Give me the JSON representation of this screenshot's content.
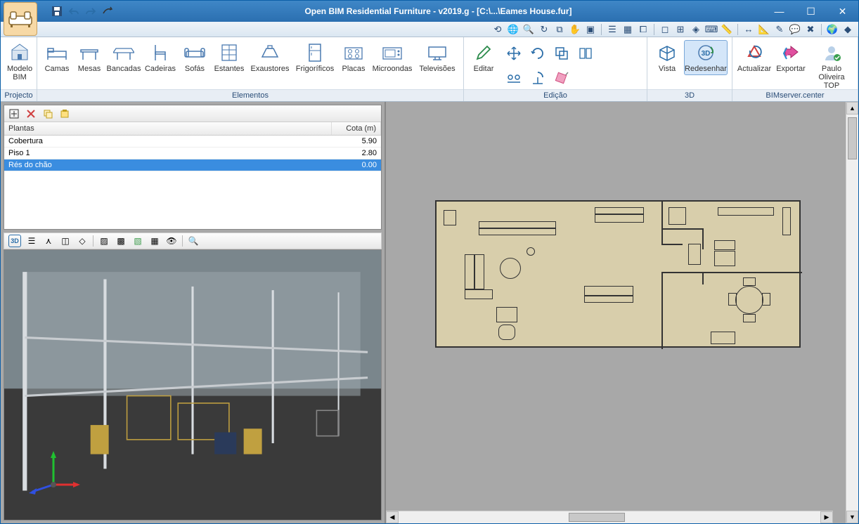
{
  "title": "Open BIM Residential Furniture - v2019.g - [C:\\...\\Eames House.fur]",
  "qat": {
    "save": "save-icon",
    "undo": "undo-icon",
    "redo": "redo-icon",
    "page": "page-icon"
  },
  "ribbon": {
    "groups": {
      "projecto": {
        "label": "Projecto",
        "items": [
          {
            "label": "Modelo BIM"
          }
        ]
      },
      "elementos": {
        "label": "Elementos",
        "items": [
          {
            "label": "Camas"
          },
          {
            "label": "Mesas"
          },
          {
            "label": "Bancadas"
          },
          {
            "label": "Cadeiras"
          },
          {
            "label": "Sofás"
          },
          {
            "label": "Estantes"
          },
          {
            "label": "Exaustores"
          },
          {
            "label": "Frigoríficos"
          },
          {
            "label": "Placas"
          },
          {
            "label": "Microondas"
          },
          {
            "label": "Televisões"
          }
        ]
      },
      "edicao": {
        "label": "Edição",
        "items": [
          {
            "label": "Editar"
          }
        ]
      },
      "tresd": {
        "label": "3D",
        "items": [
          {
            "label": "Vista"
          },
          {
            "label": "Redesenhar"
          }
        ]
      },
      "bimserver": {
        "label": "BIMserver.center",
        "items": [
          {
            "label": "Actualizar"
          },
          {
            "label": "Exportar"
          },
          {
            "label": "Paulo Oliveira TOP"
          }
        ]
      }
    }
  },
  "plantas": {
    "header_name": "Plantas",
    "header_cota": "Cota (m)",
    "rows": [
      {
        "name": "Cobertura",
        "cota": "5.90"
      },
      {
        "name": "Piso 1",
        "cota": "2.80"
      },
      {
        "name": "Rés do chão",
        "cota": "0.00"
      }
    ]
  }
}
